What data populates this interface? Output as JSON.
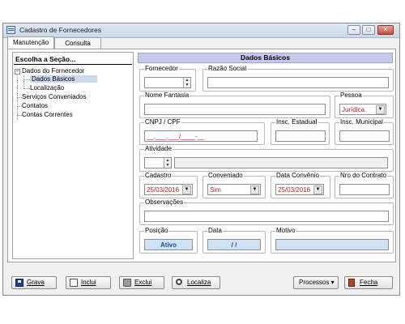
{
  "window": {
    "title": "Cadastro de Fornecedores",
    "buttons": [
      "–",
      "□",
      "✕"
    ]
  },
  "tabs": [
    "Manutenção",
    "Consulta"
  ],
  "tree": {
    "heading": "Escolha a Seção...",
    "expander": "−",
    "items": [
      "Dados do Fornecedor",
      "Dados Básicos",
      "Localização",
      "Serviços Conveniados",
      "Contatos",
      "Contas Correntes"
    ]
  },
  "section_title": "Dados Básicos",
  "form": {
    "fornecedor_label": "Fornecedor",
    "fornecedor_value": "",
    "razao_label": "Razão Social",
    "razao_value": "",
    "fantasia_label": "Nome Fantasia",
    "fantasia_value": "",
    "pessoa_label": "Pessoa",
    "pessoa_value": "Jurídica",
    "cnpj_label": "CNPJ / CPF",
    "cnpj_value": "__.___.___/____-__",
    "ie_label": "Insc. Estadual",
    "ie_value": "",
    "im_label": "Insc. Municipal",
    "im_value": "",
    "atividade_label": "Atividade",
    "atividade_value": "",
    "atividade_desc": "",
    "cadastro_label": "Cadastro",
    "cadastro_value": "25/03/2016",
    "conveniado_label": "Conveniado",
    "conveniado_value": "Sim",
    "data_convenio_label": "Data Convênio",
    "data_convenio_value": "25/03/2016",
    "contrato_label": "Nro do Contrato",
    "contrato_value": "",
    "obs_label": "Observações",
    "obs_value": "",
    "posicao_label": "Posição",
    "posicao_value": "Ativo",
    "data_label": "Data",
    "data_value": "/ /",
    "motivo_label": "Motivo",
    "motivo_value": ""
  },
  "footer": {
    "grava": "Grava",
    "inclui": "Inclui",
    "exclui": "Exclui",
    "localiza": "Localiza",
    "processos": "Processos ▾",
    "fecha": "Fecha"
  },
  "colors": {
    "section_header": "#c5c9ec",
    "selection": "#cbd9ef",
    "status_blue": "#cfe2f3",
    "value_red": "#b22222"
  }
}
